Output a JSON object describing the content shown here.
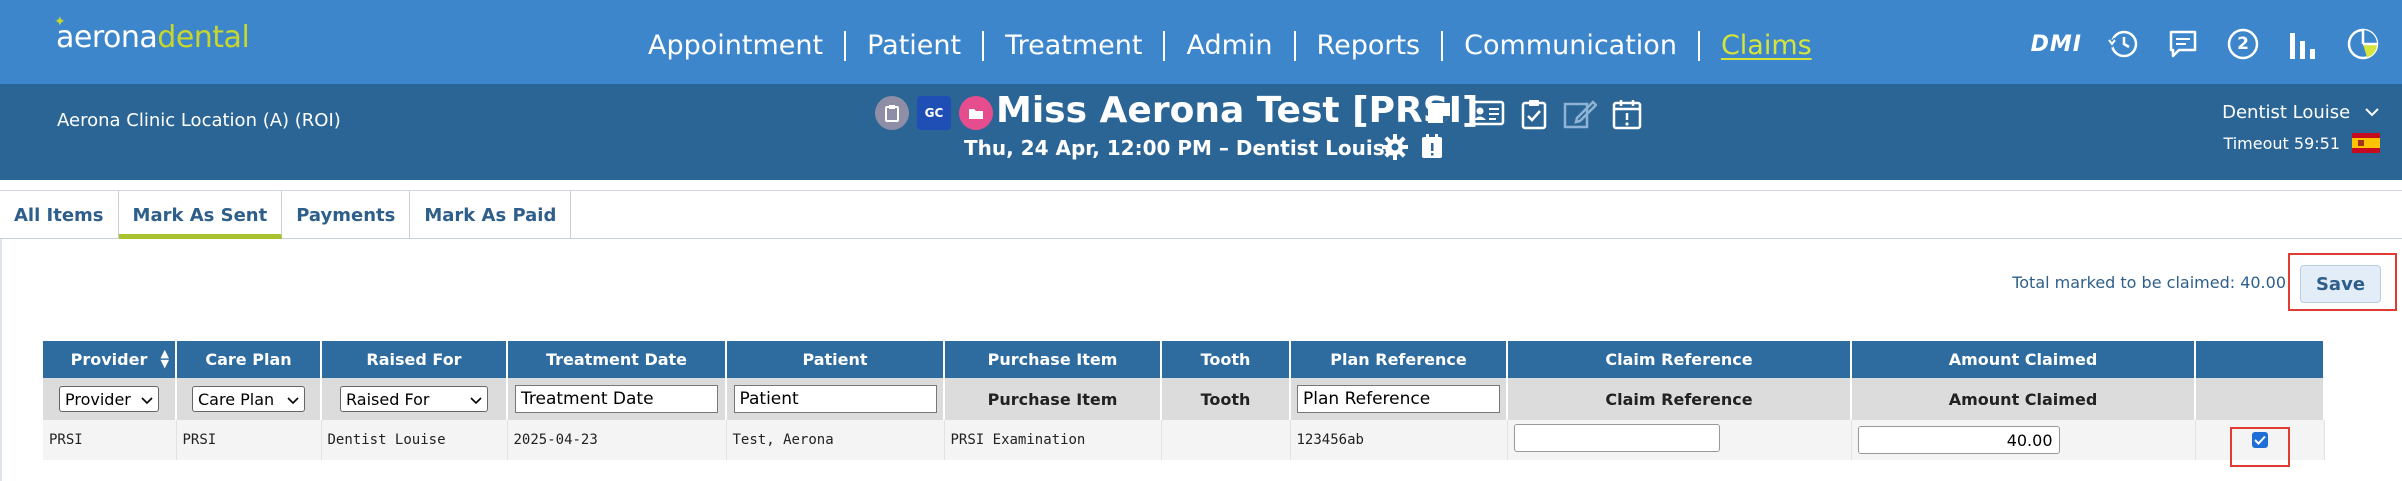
{
  "brand": {
    "logo_part1": "aerona",
    "logo_part2": "dental"
  },
  "nav": {
    "items": [
      {
        "label": "Appointment"
      },
      {
        "label": "Patient"
      },
      {
        "label": "Treatment"
      },
      {
        "label": "Admin"
      },
      {
        "label": "Reports"
      },
      {
        "label": "Communication"
      },
      {
        "label": "Claims"
      }
    ],
    "active": "Claims"
  },
  "top_icons": {
    "dmi_label": "DMI",
    "notifications_count": "2",
    "icons": [
      "history-icon",
      "chat-icon",
      "notification-count-icon",
      "bar-chart-icon",
      "pie-chart-icon"
    ]
  },
  "patient_header": {
    "clinic": "Aerona Clinic Location (A) (ROI)",
    "badge_gc": "GC",
    "patient_name": "Miss Aerona Test [PRSI]",
    "appointment": "Thu, 24 Apr, 12:00 PM –  Dentist Louise",
    "user": "Dentist Louise",
    "timeout": "Timeout 59:51"
  },
  "tabs": [
    {
      "label": "All Items"
    },
    {
      "label": "Mark As Sent"
    },
    {
      "label": "Payments"
    },
    {
      "label": "Mark As Paid"
    }
  ],
  "active_tab": "Mark As Sent",
  "summary": {
    "total_label": "Total marked to be claimed:  40.00",
    "save_label": "Save"
  },
  "table": {
    "headers": [
      "Provider",
      "Care Plan",
      "Raised For",
      "Treatment Date",
      "Patient",
      "Purchase Item",
      "Tooth",
      "Plan Reference",
      "Claim Reference",
      "Amount Claimed",
      ""
    ],
    "filters": {
      "provider": "Provider",
      "care_plan": "Care Plan",
      "raised_for": "Raised For",
      "treatment_date": "Treatment Date",
      "patient": "Patient",
      "purchase_item": "Purchase Item",
      "tooth": "Tooth",
      "plan_reference": "Plan Reference",
      "claim_reference": "Claim Reference",
      "amount_claimed": "Amount Claimed"
    },
    "row": {
      "provider": "PRSI",
      "care_plan": "PRSI",
      "raised_for": "Dentist Louise",
      "treatment_date": "2025-04-23",
      "patient": "Test, Aerona",
      "purchase_item": "PRSI Examination",
      "tooth": "",
      "plan_reference": "123456ab",
      "claim_reference": "",
      "amount_claimed": "40.00",
      "selected": true
    }
  },
  "colors": {
    "nav_bg": "#3d86cc",
    "header_bg": "#2b6596",
    "accent": "#d4e43a",
    "table_header": "#2e6b9f",
    "highlight": "#e03c31"
  }
}
